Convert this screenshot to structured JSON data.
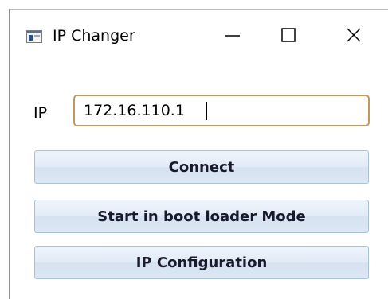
{
  "window": {
    "title": "IP Changer",
    "minimize_label": "Minimize",
    "maximize_label": "Maximize",
    "close_label": "Close",
    "icon": "application-icon"
  },
  "form": {
    "ip_label": "IP",
    "ip_value": "172.16.110.1"
  },
  "buttons": {
    "connect": "Connect",
    "boot_loader": "Start in boot loader Mode",
    "ip_configuration": "IP Configuration"
  },
  "colors": {
    "input_border": "#c3985f",
    "button_border": "#a9c1dd",
    "button_fill": "#e2ebf6"
  }
}
